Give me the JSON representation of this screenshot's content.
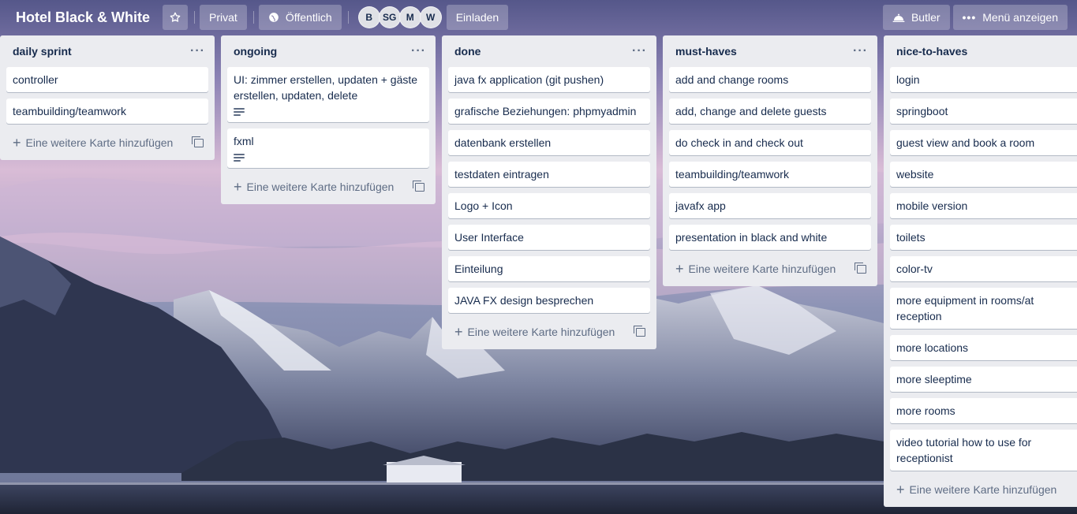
{
  "header": {
    "board_title": "Hotel Black & White",
    "private_label": "Privat",
    "public_label": "Öffentlich",
    "members": [
      "B",
      "SG",
      "M",
      "W"
    ],
    "invite_label": "Einladen",
    "butler_label": "Butler",
    "menu_label": "Menü anzeigen"
  },
  "lists": [
    {
      "title": "daily sprint",
      "cards": [
        {
          "text": "controller",
          "has_description": false
        },
        {
          "text": "teambuilding/teamwork",
          "has_description": false
        }
      ],
      "add_label": "Eine weitere Karte hinzufügen"
    },
    {
      "title": "ongoing",
      "cards": [
        {
          "text": "UI: zimmer erstellen, updaten + gäste erstellen, updaten, delete",
          "has_description": true
        },
        {
          "text": "fxml",
          "has_description": true
        }
      ],
      "add_label": "Eine weitere Karte hinzufügen"
    },
    {
      "title": "done",
      "cards": [
        {
          "text": "java fx application (git pushen)",
          "has_description": false
        },
        {
          "text": "grafische Beziehungen: phpmyadmin",
          "has_description": false
        },
        {
          "text": "datenbank erstellen",
          "has_description": false
        },
        {
          "text": "testdaten eintragen",
          "has_description": false
        },
        {
          "text": "Logo + Icon",
          "has_description": false
        },
        {
          "text": "User Interface",
          "has_description": false
        },
        {
          "text": "Einteilung",
          "has_description": false
        },
        {
          "text": "JAVA FX design besprechen",
          "has_description": false
        }
      ],
      "add_label": "Eine weitere Karte hinzufügen"
    },
    {
      "title": "must-haves",
      "cards": [
        {
          "text": "add and change rooms",
          "has_description": false
        },
        {
          "text": "add, change and delete guests",
          "has_description": false
        },
        {
          "text": "do check in and check out",
          "has_description": false
        },
        {
          "text": "teambuilding/teamwork",
          "has_description": false
        },
        {
          "text": "javafx app",
          "has_description": false
        },
        {
          "text": "presentation in black and white",
          "has_description": false
        }
      ],
      "add_label": "Eine weitere Karte hinzufügen"
    },
    {
      "title": "nice-to-haves",
      "cards": [
        {
          "text": "login",
          "has_description": false
        },
        {
          "text": "springboot",
          "has_description": false
        },
        {
          "text": "guest view and book a room",
          "has_description": false
        },
        {
          "text": "website",
          "has_description": false
        },
        {
          "text": "mobile version",
          "has_description": false
        },
        {
          "text": "toilets",
          "has_description": false
        },
        {
          "text": "color-tv",
          "has_description": false
        },
        {
          "text": "more equipment in rooms/at reception",
          "has_description": false
        },
        {
          "text": "more locations",
          "has_description": false
        },
        {
          "text": "more sleeptime",
          "has_description": false
        },
        {
          "text": "more rooms",
          "has_description": false
        },
        {
          "text": "video tutorial how to use for receptionist",
          "has_description": false
        }
      ],
      "add_label": "Eine weitere Karte hinzufügen"
    }
  ],
  "icons": {
    "star": "star-icon",
    "public": "globe-icon",
    "butler": "butler-bell-icon",
    "menu": "more-dots-icon",
    "list_menu": "ellipsis-icon",
    "add": "plus-icon",
    "template": "card-template-icon",
    "description": "description-lines-icon"
  }
}
